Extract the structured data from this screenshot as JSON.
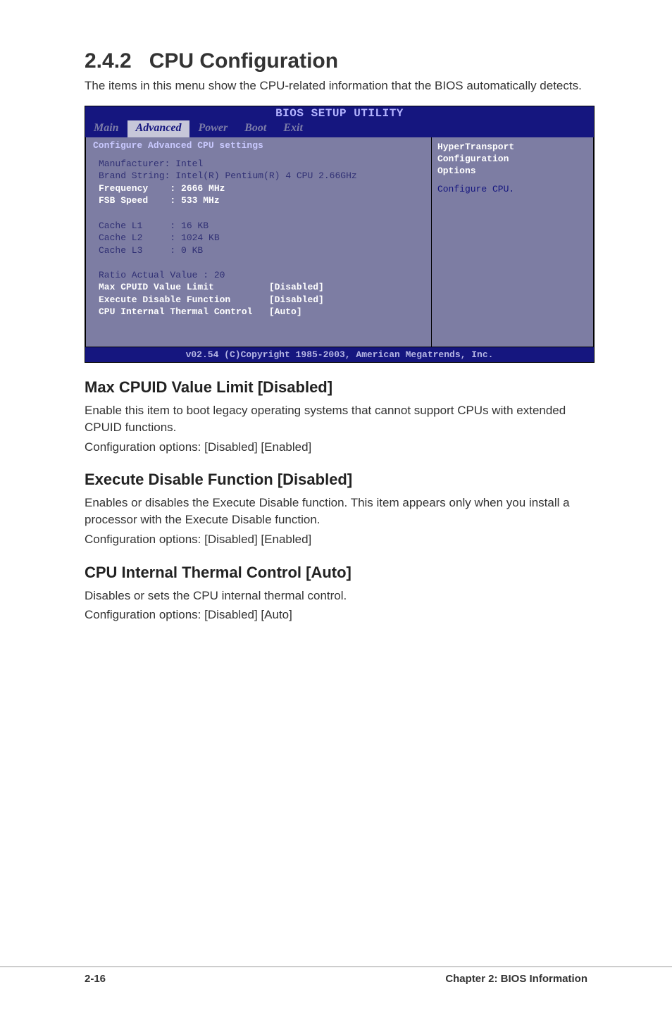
{
  "section": {
    "number": "2.4.2",
    "title": "CPU Configuration",
    "lead": "The items in this menu show the CPU-related information that the BIOS automatically detects."
  },
  "bios": {
    "title": "BIOS SETUP UTILITY",
    "tabs": [
      "Main",
      "Advanced",
      "Power",
      "Boot",
      "Exit"
    ],
    "active_tab": "Advanced",
    "left_title": "Configure Advanced CPU settings",
    "content": {
      "manufacturer_label": "Manufacturer:",
      "manufacturer_value": "Intel",
      "brand_string_label": "Brand String:",
      "brand_string_value": "Intel(R) Pentium(R) 4 CPU 2.66GHz",
      "frequency_label": "Frequency",
      "frequency_value": "2666 MHz",
      "fsb_speed_label": "FSB Speed",
      "fsb_speed_value": "533 MHz",
      "cache_l1_label": "Cache L1",
      "cache_l1_value": "16 KB",
      "cache_l2_label": "Cache L2",
      "cache_l2_value": "1024 KB",
      "cache_l3_label": "Cache L3",
      "cache_l3_value": "0 KB",
      "ratio_label": "Ratio Actual Value :",
      "ratio_value": "20",
      "max_cpuid_label": "Max CPUID Value Limit",
      "max_cpuid_value": "[Disabled]",
      "exec_disable_label": "Execute Disable Function",
      "exec_disable_value": "[Disabled]",
      "cpu_thermal_label": "CPU Internal Thermal Control",
      "cpu_thermal_value": "[Auto]"
    },
    "help": {
      "line1": "HyperTransport",
      "line2": "Configuration",
      "line3": "Options",
      "body": "Configure CPU."
    },
    "footer": "v02.54 (C)Copyright 1985-2003, American Megatrends, Inc."
  },
  "sub1": {
    "title": "Max CPUID Value Limit [Disabled]",
    "p1": "Enable this item to boot legacy operating systems that cannot support CPUs with extended CPUID functions.",
    "p2": "Configuration options: [Disabled] [Enabled]"
  },
  "sub2": {
    "title": "Execute Disable Function [Disabled]",
    "p1": "Enables or disables the Execute Disable function. This item appears only when you install a processor with the Execute Disable function.",
    "p2": "Configuration options: [Disabled] [Enabled]"
  },
  "sub3": {
    "title": "CPU Internal Thermal Control [Auto]",
    "p1": "Disables or sets the CPU internal thermal control.",
    "p2": "Configuration options: [Disabled] [Auto]"
  },
  "footer": {
    "page": "2-16",
    "chapter": "Chapter 2: BIOS Information"
  }
}
